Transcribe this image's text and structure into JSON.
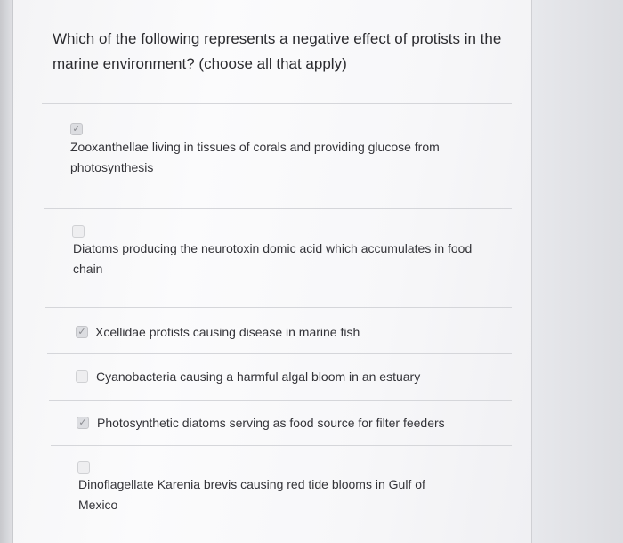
{
  "question": {
    "text": "Which of the following represents a negative effect of protists in the marine environment? (choose all that apply)"
  },
  "options": [
    {
      "label": "Zooxanthellae living in tissues of corals and providing glucose from photosynthesis",
      "checked": true
    },
    {
      "label": "Diatoms producing the neurotoxin domic acid which accumulates in food chain",
      "checked": false
    },
    {
      "label": "Xcellidae protists causing disease in marine fish",
      "checked": true
    },
    {
      "label": "Cyanobacteria causing a harmful algal bloom in an estuary",
      "checked": false
    },
    {
      "label": "Photosynthetic diatoms serving as food source for filter feeders",
      "checked": true
    },
    {
      "label": "Dinoflagellate Karenia brevis causing red tide blooms in Gulf of Mexico",
      "checked": false
    }
  ],
  "icons": {
    "checked": "checkmark-icon",
    "unchecked": "empty-checkbox-icon"
  },
  "check_glyph": "✓",
  "colors": {
    "text": "#333338",
    "divider": "#d5d6da"
  }
}
